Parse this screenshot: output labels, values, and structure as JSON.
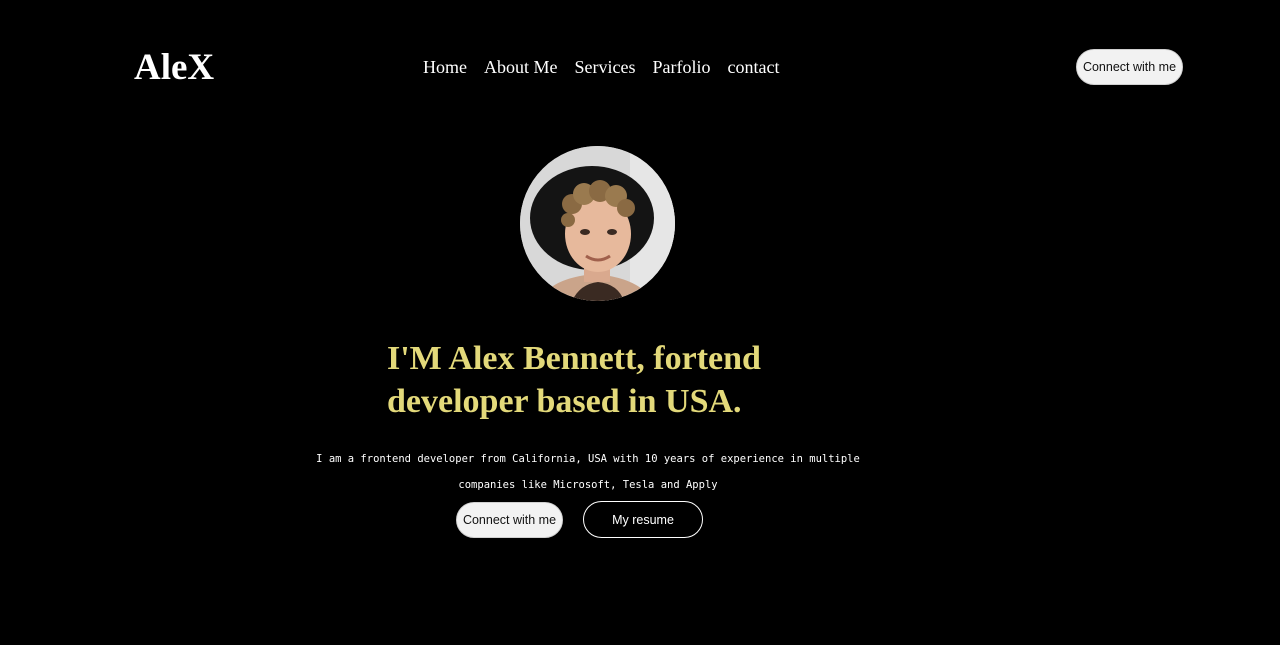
{
  "header": {
    "logo": "AleX",
    "nav": [
      {
        "label": "Home"
      },
      {
        "label": "About Me"
      },
      {
        "label": "Services"
      },
      {
        "label": "Parfolio"
      },
      {
        "label": "contact"
      }
    ],
    "cta_label": "Connect with me"
  },
  "hero": {
    "avatar_alt": "profile photo",
    "headline_line1": "I'M Alex Bennett, fortend",
    "headline_line2": "developer based in USA.",
    "description_line1": "I am a frontend developer from California, USA with 10 years of experience in multiple",
    "description_line2": "companies like Microsoft, Tesla and Apply",
    "primary_button": "Connect with me",
    "secondary_button": "My resume"
  },
  "colors": {
    "background": "#000000",
    "headline": "#e3d97a",
    "button_light": "#f2f2f2"
  }
}
